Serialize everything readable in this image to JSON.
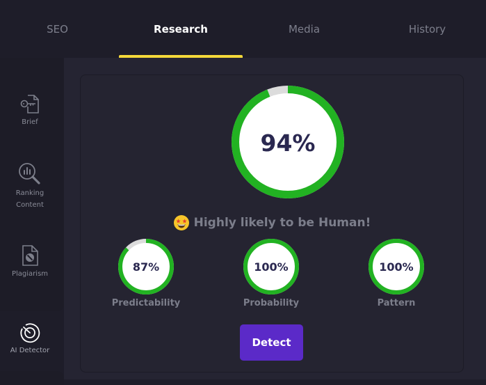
{
  "tabs": [
    {
      "label": "SEO",
      "active": false
    },
    {
      "label": "Research",
      "active": true
    },
    {
      "label": "Media",
      "active": false
    },
    {
      "label": "History",
      "active": false
    }
  ],
  "sidebar": {
    "items": [
      {
        "label": "Brief",
        "icon": "document-key-icon"
      },
      {
        "label": "Ranking\nContent",
        "icon": "search-chart-icon"
      },
      {
        "label": "Plagiarism",
        "icon": "document-block-icon"
      },
      {
        "label": "AI Detector",
        "icon": "detector-dial-icon",
        "active": true
      }
    ]
  },
  "detector": {
    "overall": {
      "value": 94,
      "label": "94%"
    },
    "verdict": "Highly likely to be Human!",
    "verdict_emoji": "star-struck-emoji",
    "metrics": [
      {
        "name": "Predictability",
        "value": 87,
        "label": "87%"
      },
      {
        "name": "Probability",
        "value": 100,
        "label": "100%"
      },
      {
        "name": "Pattern",
        "value": 100,
        "label": "100%"
      }
    ],
    "detect_button": "Detect"
  },
  "colors": {
    "ring_fill": "#22b222",
    "ring_track": "#dcdcdc",
    "accent_tab": "#f4d83a",
    "button": "#5b2ac8"
  }
}
